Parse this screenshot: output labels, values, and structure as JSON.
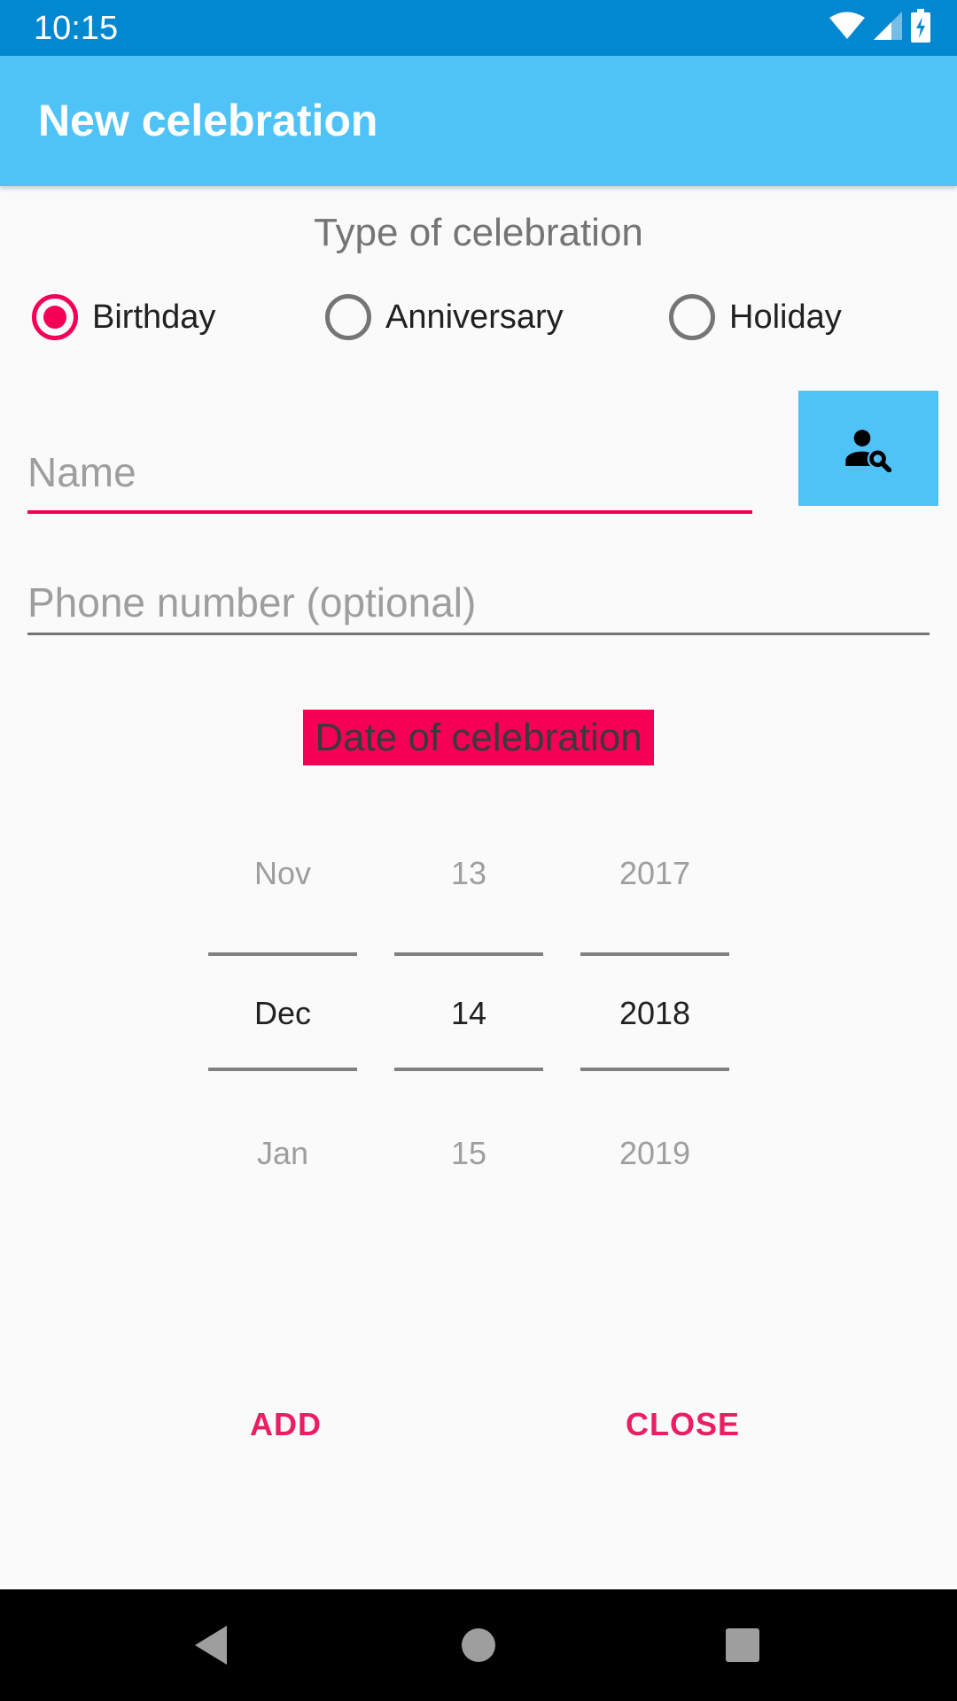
{
  "status_bar": {
    "time": "10:15"
  },
  "app_bar": {
    "title": "New celebration"
  },
  "type_section": {
    "heading": "Type of celebration",
    "options": [
      {
        "label": "Birthday",
        "checked": true
      },
      {
        "label": "Anniversary",
        "checked": false
      },
      {
        "label": "Holiday",
        "checked": false
      }
    ]
  },
  "form": {
    "name": {
      "placeholder": "Name",
      "value": ""
    },
    "phone": {
      "placeholder": "Phone number (optional)",
      "value": ""
    },
    "contact_button_icon": "contact-search-icon"
  },
  "date_section": {
    "label": "Date of celebration",
    "month": {
      "prev": "Nov",
      "current": "Dec",
      "next": "Jan"
    },
    "day": {
      "prev": "13",
      "current": "14",
      "next": "15"
    },
    "year": {
      "prev": "2017",
      "current": "2018",
      "next": "2019"
    }
  },
  "actions": {
    "add": "ADD",
    "close": "CLOSE"
  },
  "colors": {
    "status_bar": "#0288d1",
    "app_bar": "#4fc3f7",
    "accent": "#f50057"
  }
}
